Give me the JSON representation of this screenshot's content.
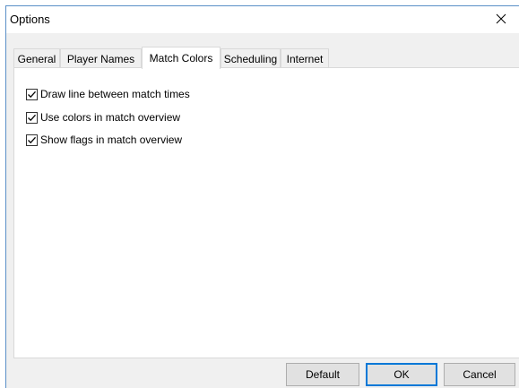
{
  "window": {
    "title": "Options",
    "close_symbol": "×"
  },
  "tabs": [
    {
      "label": "General",
      "active": false
    },
    {
      "label": "Player Names",
      "active": false
    },
    {
      "label": "Match Colors",
      "active": true
    },
    {
      "label": "Scheduling",
      "active": false
    },
    {
      "label": "Internet",
      "active": false
    }
  ],
  "options": [
    {
      "label": "Draw line between match times",
      "checked": true
    },
    {
      "label": "Use colors in match overview",
      "checked": true
    },
    {
      "label": "Show flags in match overview",
      "checked": true
    }
  ],
  "buttons": {
    "default": "Default",
    "ok": "OK",
    "cancel": "Cancel"
  },
  "colors": {
    "accent": "#0078d7",
    "window_border": "#5a8fc7"
  },
  "icons": {
    "close": "close-icon",
    "check": "check-icon"
  }
}
